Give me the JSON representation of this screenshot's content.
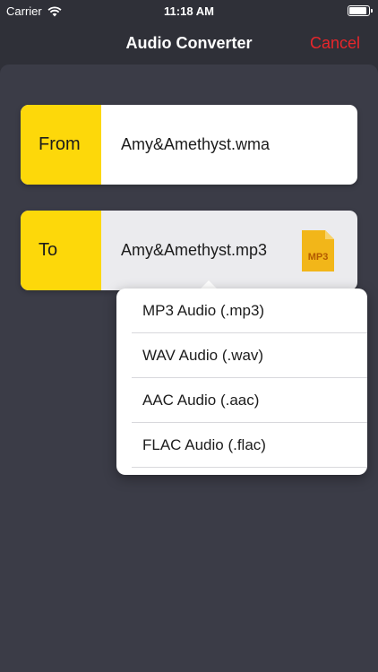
{
  "status_bar": {
    "carrier": "Carrier",
    "time": "11:18 AM",
    "wifi_icon": "wifi-icon",
    "battery_icon": "battery-icon"
  },
  "nav": {
    "title": "Audio Converter",
    "cancel_label": "Cancel"
  },
  "from": {
    "label": "From",
    "file_name": "Amy&Amethyst.wma"
  },
  "to": {
    "label": "To",
    "file_name": "Amy&Amethyst.mp3",
    "format_icon": "mp3-file-icon",
    "format_badge": "MP3"
  },
  "format_menu": {
    "items": [
      {
        "label": "MP3 Audio (.mp3)"
      },
      {
        "label": "WAV Audio (.wav)"
      },
      {
        "label": "AAC Audio (.aac)"
      },
      {
        "label": "FLAC Audio (.flac)"
      }
    ]
  },
  "colors": {
    "background": "#2f3038",
    "panel": "#3b3c47",
    "accent_yellow": "#fdd80a",
    "cancel_red": "#e8262b",
    "file_icon": "#f2b619"
  }
}
